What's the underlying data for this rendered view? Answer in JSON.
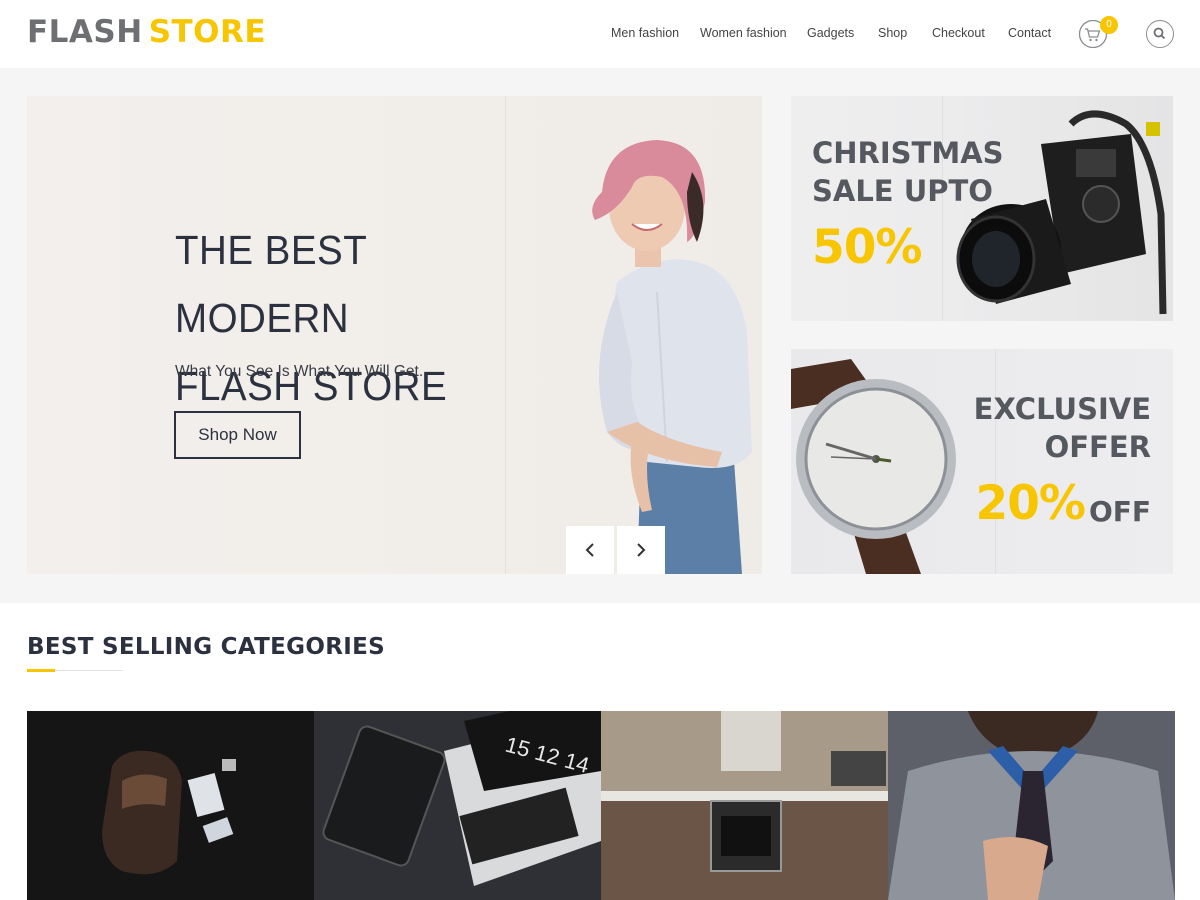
{
  "header": {
    "logo": {
      "part1": "FLASH",
      "part2": "STORE"
    },
    "nav": [
      "Men fashion",
      "Women fashion",
      "Gadgets",
      "Shop",
      "Checkout",
      "Contact"
    ],
    "cart_count": "0",
    "icons": {
      "cart": "shopping-cart-icon",
      "search": "search-icon"
    }
  },
  "hero": {
    "title_line1": "THE BEST MODERN",
    "title_line2": "FLASH STORE",
    "subtitle": "What You See Is What You Will Get.",
    "cta": "Shop Now",
    "controls": {
      "prev": "chevron-left-icon",
      "next": "chevron-right-icon"
    }
  },
  "promos": [
    {
      "line1": "CHRISTMAS",
      "line2": "SALE UPTO",
      "highlight": "50%",
      "image": "camera"
    },
    {
      "line1": "EXCLUSIVE",
      "line2": "OFFER",
      "highlight": "20%",
      "suffix": "OFF",
      "image": "watch"
    }
  ],
  "categories": {
    "heading": "BEST SELLING CATEGORIES",
    "tiles": [
      {
        "image": "backpack"
      },
      {
        "image": "laptop-tablet"
      },
      {
        "image": "kitchen"
      },
      {
        "image": "man-sweater"
      }
    ]
  },
  "colors": {
    "accent": "#f7c600",
    "dark": "#2c3140",
    "logo_gray": "#6d6f73"
  }
}
